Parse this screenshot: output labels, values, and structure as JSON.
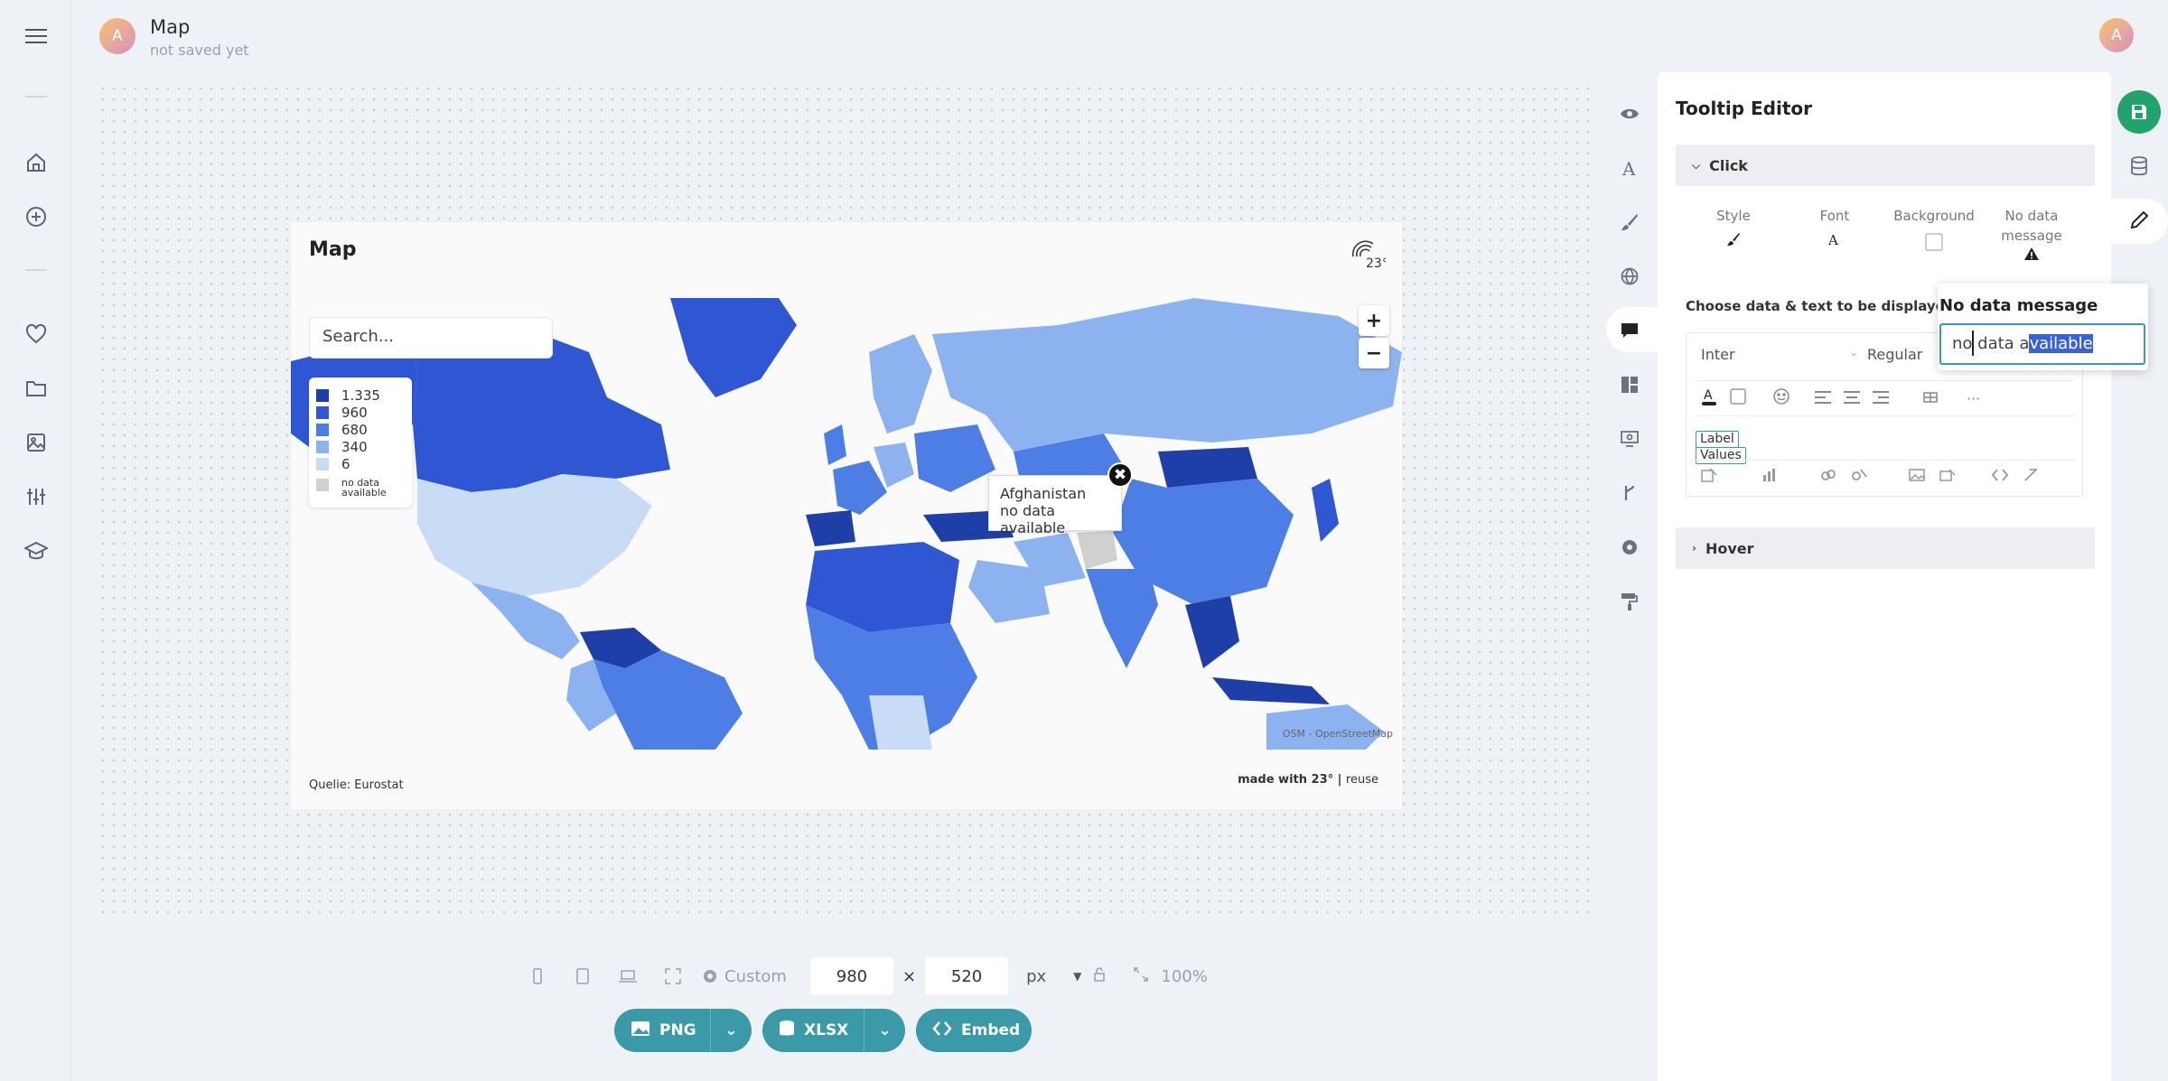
{
  "header": {
    "title": "Map",
    "subtitle": "not saved yet",
    "avatar_initial": "A",
    "user_avatar_initial": "A"
  },
  "left_nav": {
    "icons": [
      "menu-icon",
      "home-icon",
      "plus-circle-icon",
      "heart-icon",
      "folder-icon",
      "image-icon",
      "sliders-icon",
      "graduation-cap-icon"
    ]
  },
  "card": {
    "title": "Map",
    "search_placeholder": "Search...",
    "source": "Quelie: Eurostat",
    "made_with": "made with 23° | ",
    "reuse": "reuse",
    "osm_credit": "OSM - OpenStreetMap",
    "legend": [
      {
        "label": "1.335",
        "color": "#1f3fa8"
      },
      {
        "label": "960",
        "color": "#2f57d4"
      },
      {
        "label": "680",
        "color": "#4c7ee6"
      },
      {
        "label": "340",
        "color": "#8cb3ef"
      },
      {
        "label": "6",
        "color": "#c9dcf6"
      }
    ],
    "legend_no_data": "no data available",
    "legend_no_data_color": "#d0d0d0",
    "zoom_in": "+",
    "zoom_out": "−",
    "tooltip": {
      "country": "Afghanistan",
      "message": "no data available",
      "close": "✖"
    }
  },
  "toolbar": {
    "preset": "Custom",
    "width": "980",
    "times": "×",
    "height": "520",
    "unit": "px",
    "zoom": "100%",
    "png_label": "PNG",
    "xlsx_label": "XLSX",
    "embed_label": "Embed"
  },
  "editor": {
    "title": "Tooltip Editor",
    "click_section": "Click",
    "hover_section": "Hover",
    "options": [
      {
        "label": "Style"
      },
      {
        "label": "Font"
      },
      {
        "label": "Background"
      },
      {
        "label": "No data message"
      }
    ],
    "choose_label": "Choose data & text to be displayed",
    "font_family": "Inter",
    "font_weight": "Regular",
    "chip_label": "Label",
    "chip_values": "Values"
  },
  "popover": {
    "title": "No data message",
    "value_plain": "no data a",
    "value_selected": "vailable"
  },
  "colors": {
    "accent": "#3a9aa8",
    "save": "#22a36b",
    "selection": "#3a62d6"
  }
}
